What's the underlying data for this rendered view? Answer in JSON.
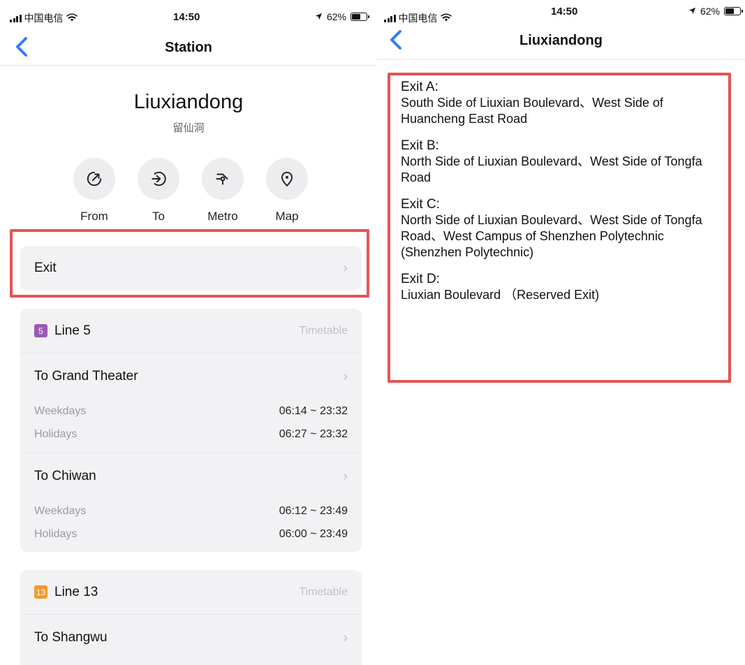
{
  "status": {
    "carrier": "中国电信",
    "time": "14:50",
    "battery": "62%"
  },
  "left": {
    "nav_title": "Station",
    "station_name": "Liuxiandong",
    "station_name_cn": "留仙洞",
    "actions": [
      {
        "label": "From",
        "icon": "arrow-up-right-circle-icon"
      },
      {
        "label": "To",
        "icon": "arrow-right-circle-icon"
      },
      {
        "label": "Metro",
        "icon": "metro-route-icon"
      },
      {
        "label": "Map",
        "icon": "map-pin-icon"
      }
    ],
    "exit_label": "Exit",
    "timetable_label": "Timetable",
    "lines": [
      {
        "badge": "5",
        "color": "#9b59b6",
        "name": "Line 5",
        "directions": [
          {
            "to": "To Grand Theater",
            "weekdays_label": "Weekdays",
            "weekdays": "06:14 ~ 23:32",
            "holidays_label": "Holidays",
            "holidays": "06:27 ~ 23:32"
          },
          {
            "to": "To Chiwan",
            "weekdays_label": "Weekdays",
            "weekdays": "06:12 ~ 23:49",
            "holidays_label": "Holidays",
            "holidays": "06:00 ~ 23:49"
          }
        ]
      },
      {
        "badge": "13",
        "color": "#f39a2c",
        "name": "Line 13",
        "directions": [
          {
            "to": "To Shangwu"
          }
        ]
      }
    ]
  },
  "right": {
    "nav_title": "Liuxiandong",
    "exits": [
      {
        "label": "Exit A:",
        "desc": "South Side of Liuxian Boulevard、West Side of Huancheng East Road"
      },
      {
        "label": "Exit B:",
        "desc": "North Side of Liuxian Boulevard、West Side of Tongfa Road"
      },
      {
        "label": "Exit C:",
        "desc": "North Side of Liuxian Boulevard、West Side of Tongfa Road、West Campus of Shenzhen Polytechnic (Shenzhen Polytechnic)"
      },
      {
        "label": "Exit D:",
        "desc": "Liuxian Boulevard （Reserved Exit)"
      }
    ]
  },
  "colors": {
    "accent": "#2f7cf6",
    "highlight": "#e55454",
    "line5": "#9b59b6",
    "line13": "#f39a2c"
  }
}
